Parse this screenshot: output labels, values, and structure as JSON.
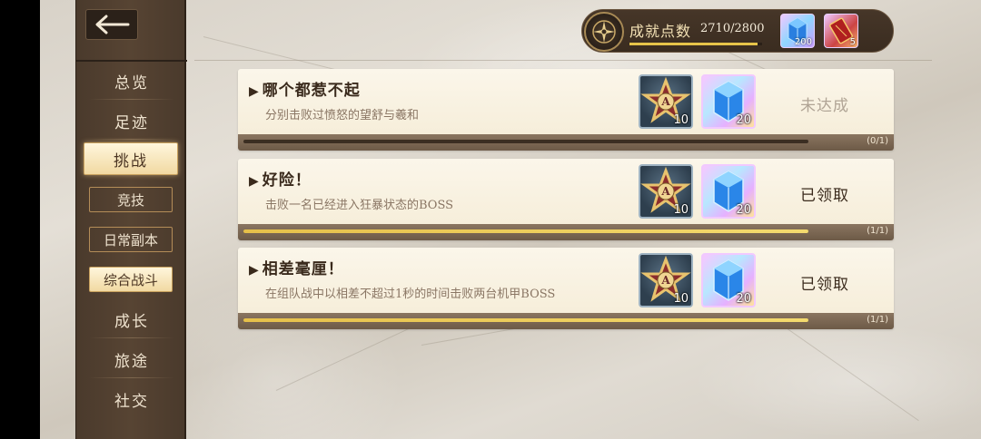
{
  "header": {
    "points_label": "成就点数",
    "points_value": "2710/2800",
    "points_progress": 0.968,
    "rewards": [
      {
        "icon": "blue-crystal-icon",
        "count": "200"
      },
      {
        "icon": "red-scroll-icon",
        "count": "5"
      }
    ]
  },
  "sidebar": {
    "items": [
      {
        "label": "总览"
      },
      {
        "label": "足迹"
      },
      {
        "label": "挑战",
        "active": true
      },
      {
        "label": "竞技",
        "sub": true
      },
      {
        "label": "日常副本",
        "sub": true
      },
      {
        "label": "综合战斗",
        "sub": true,
        "active": true
      },
      {
        "label": "成长"
      },
      {
        "label": "旅途"
      },
      {
        "label": "社交"
      }
    ]
  },
  "achievements": [
    {
      "title": "哪个都惹不起",
      "desc": "分别击败过愤怒的望舒与羲和",
      "rewards": [
        {
          "icon": "star-medal-icon",
          "count": "10"
        },
        {
          "icon": "blue-crystal-icon",
          "count": "20"
        }
      ],
      "status": "未达成",
      "progress_text": "(0/1)",
      "progress": 0
    },
    {
      "title": "好险！",
      "desc": "击败一名已经进入狂暴状态的BOSS",
      "rewards": [
        {
          "icon": "star-medal-icon",
          "count": "10"
        },
        {
          "icon": "blue-crystal-icon",
          "count": "20"
        }
      ],
      "status": "已领取",
      "progress_text": "(1/1)",
      "progress": 1
    },
    {
      "title": "相差毫厘！",
      "desc": "在组队战中以相差不超过1秒的时间击败两台机甲BOSS",
      "rewards": [
        {
          "icon": "star-medal-icon",
          "count": "10"
        },
        {
          "icon": "blue-crystal-icon",
          "count": "20"
        }
      ],
      "status": "已领取",
      "progress_text": "(1/1)",
      "progress": 1
    }
  ],
  "colors": {
    "progress_fill": "#e7c449",
    "sidebar_bg": "#574433",
    "active_tab_bg": "#f1d9a2"
  }
}
